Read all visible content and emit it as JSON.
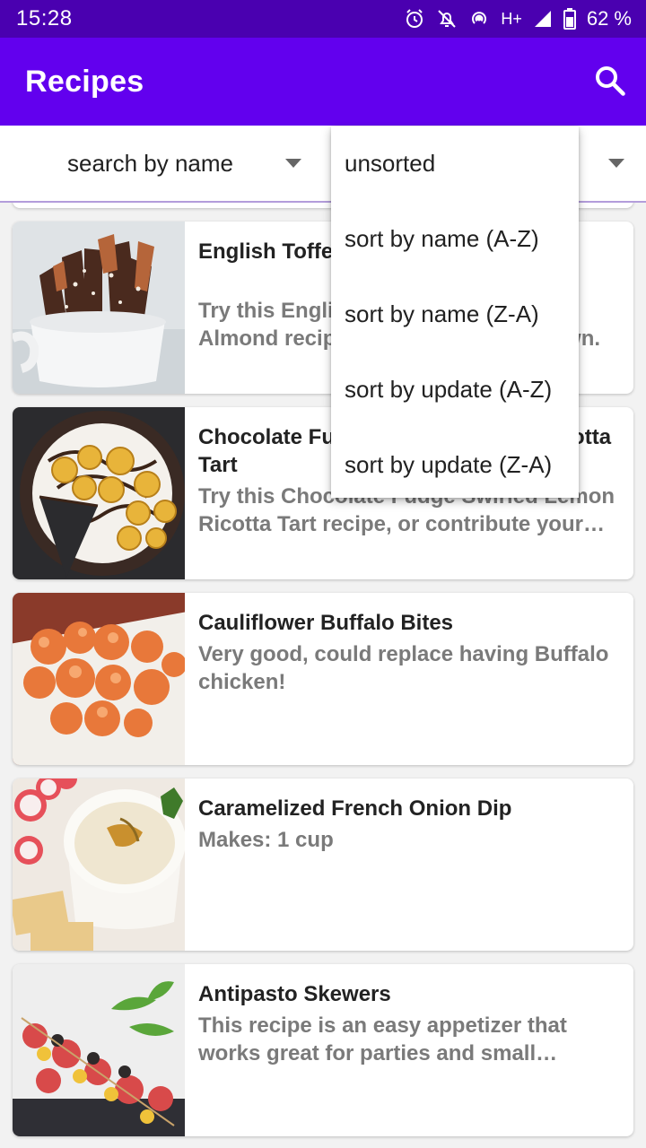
{
  "status_bar": {
    "time": "15:28",
    "network": "H+",
    "battery": "62 %"
  },
  "app_bar": {
    "title": "Recipes",
    "search_icon": "search-icon"
  },
  "filters": {
    "search_mode": "search by name",
    "sort_mode": "unsorted"
  },
  "sort_dropdown": {
    "options": [
      "unsorted",
      "sort by name (A-Z)",
      "sort by name (Z-A)",
      "sort by update (A-Z)",
      "sort by update (Z-A)"
    ]
  },
  "recipes": [
    {
      "title": "English Toffee Chocolate Almond",
      "description": "Try this English Toffee Chocolate Almond recipe, or contribute your own.",
      "image": "toffee-bark-photo"
    },
    {
      "title": "Chocolate Fudge Swirled Lemon Ricotta Tart",
      "description": "Try this Chocolate Fudge Swirled Lemon Ricotta Tart recipe, or contribute your own.",
      "image": "ricotta-tart-photo"
    },
    {
      "title": "Cauliflower Buffalo Bites",
      "description": "Very good, could replace having Buffalo chicken!",
      "image": "cauliflower-bites-photo"
    },
    {
      "title": "Caramelized French Onion Dip",
      "description": "Makes: 1 cup",
      "image": "onion-dip-photo"
    },
    {
      "title": "Antipasto Skewers",
      "description": "This recipe is an easy appetizer that works great for parties and small gatherings.",
      "image": "antipasto-skewers-photo"
    }
  ],
  "colors": {
    "status_bar": "#4a00b0",
    "app_bar": "#6200ee",
    "accent_underline": "#b39ddb"
  }
}
